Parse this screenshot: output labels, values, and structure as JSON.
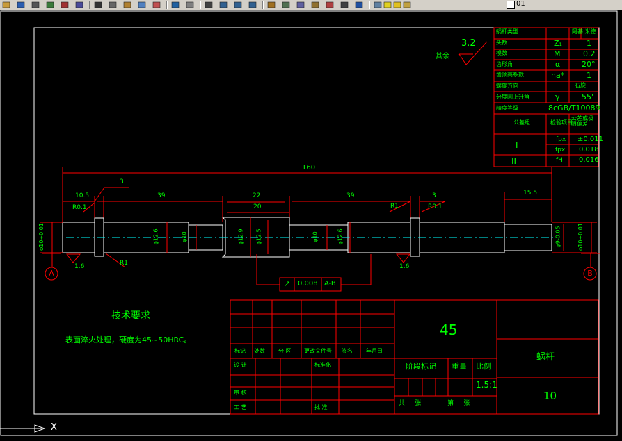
{
  "toolbar": {
    "icons": [
      "open-icon",
      "save-icon",
      "print-icon",
      "preview-icon",
      "publish-icon",
      "plot-icon",
      "cut-icon",
      "copy-icon",
      "paste-icon",
      "match-icon",
      "brush-icon",
      "undo-icon",
      "redo-icon",
      "pan-icon",
      "zoom-realtime-icon",
      "zoom-window-icon",
      "zoom-previous-icon",
      "properties-icon",
      "design-center-icon",
      "tool-palette-icon",
      "sheet-set-icon",
      "markup-icon",
      "calc-icon",
      "help-icon",
      "layers-icon",
      "lightbulb-icon",
      "sun-icon",
      "lock-icon"
    ],
    "layer_name": "01"
  },
  "params_table": {
    "rows": [
      {
        "label": "蜗杆类型",
        "symbol": "",
        "value": "阿基  米德"
      },
      {
        "label": "头数",
        "symbol": "Z₁",
        "value": "1"
      },
      {
        "label": "模数",
        "symbol": "M",
        "value": "0.2"
      },
      {
        "label": "齿形角",
        "symbol": "α",
        "value": "20°"
      },
      {
        "label": "齿顶高系数",
        "symbol": "ha*",
        "value": "1"
      },
      {
        "label": "螺旋方向",
        "symbol": "",
        "value": "右旋"
      },
      {
        "label": "分度圆上升角",
        "symbol": "γ",
        "value": "55'"
      },
      {
        "label": "精度等级",
        "symbol": "",
        "value": "8cGB/T10089"
      }
    ],
    "tol_header": {
      "group": "公差组",
      "item": "检验项目",
      "value": "公差或极限偏差"
    },
    "tol_rows": [
      {
        "group": "I",
        "item": "fpx",
        "value": "±0.011"
      },
      {
        "group": "",
        "item": "fpxl",
        "value": "0.018"
      },
      {
        "group": "II",
        "item": "fH",
        "value": "0.016"
      }
    ]
  },
  "roughness": {
    "value": "3.2",
    "label": "其余"
  },
  "dimensions": {
    "overall": "160",
    "d10_5": "10.5",
    "d3_left": "3",
    "d39_left": "39",
    "d22": "22",
    "d20": "20",
    "d39_right": "39",
    "d3_right": "3",
    "d15_5": "15.5",
    "r01_left": "R0.1",
    "r1_left": "R1",
    "r1_right": "R1",
    "r01_right": "R0.1",
    "dia_left_end": "φ10+0.01",
    "dia_12_6_left": "φ12.6",
    "dia_10_left": "φ10",
    "dia_12_9": "φ12.9",
    "dia_12_5": "φ12.5",
    "dia_10_right": "φ10",
    "dia_12_6_right": "φ12.6",
    "dia_9": "φ9-0.05",
    "dia_right_end": "φ10+0.01",
    "rough_left": "1.6",
    "rough_right": "1.6"
  },
  "datums": {
    "left": "A",
    "right": "B"
  },
  "tolerance_frame": {
    "symbol": "↗",
    "value": "0.008",
    "datum": "A-B"
  },
  "tech_req": {
    "title": "技术要求",
    "text": "表面淬火处理，硬度为45~50HRC。"
  },
  "title_block": {
    "material": "45",
    "part_name": "蜗杆",
    "drawing_no": "10",
    "headers": [
      "标记",
      "处数",
      "分  区",
      "更改文件号",
      "签名",
      "年月日"
    ],
    "design": "设 计",
    "standardize": "标准化",
    "review": "审 核",
    "process": "工 艺",
    "approve": "批 准",
    "stage_mark": "阶段标记",
    "weight": "重量",
    "scale_label": "比例",
    "scale": "1.5:1",
    "total": "共     张",
    "sheet": "第     张"
  },
  "ucs": {
    "x_label": "X"
  },
  "colors": {
    "frame": "#ffffff",
    "table": "#ff0000",
    "text": "#00ff00",
    "center": "#00ffff",
    "toolbar": "#d4d0c8"
  }
}
